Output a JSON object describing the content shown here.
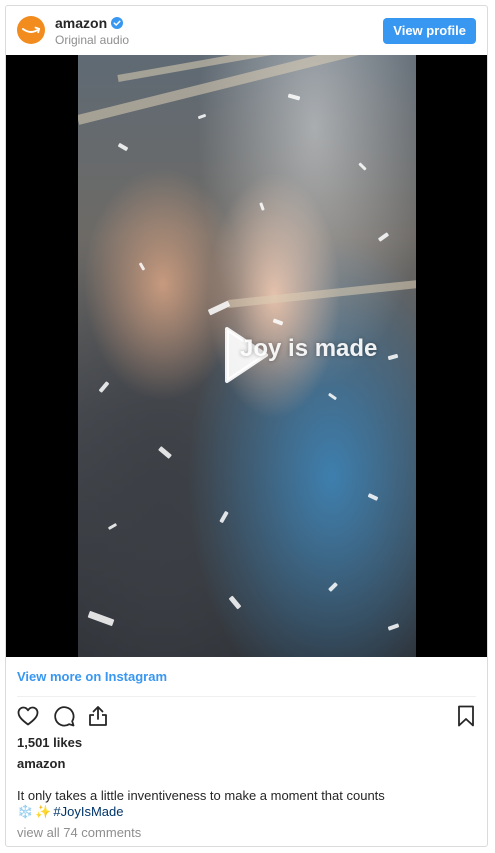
{
  "header": {
    "account_name": "amazon",
    "subtitle": "Original audio",
    "view_profile_label": "View profile"
  },
  "media": {
    "overlay_text": "Joy is made"
  },
  "footer": {
    "view_more_label": "View more on Instagram",
    "likes": "1,501 likes",
    "author": "amazon",
    "caption_text": "It only takes a little inventiveness to make a moment that counts",
    "caption_emoji_1": "❄️",
    "caption_emoji_2": "✨",
    "hashtag": "#JoyIsMade",
    "comments_label": "view all 74 comments"
  },
  "icons": [
    "amazon-logo-icon",
    "verified-icon",
    "play-icon",
    "heart-icon",
    "comment-icon",
    "share-icon",
    "bookmark-icon"
  ],
  "colors": {
    "accent": "#3897f0",
    "avatar": "#f28c1e",
    "text": "#262626",
    "muted": "#8e8e8e",
    "hashtag": "#003569"
  }
}
